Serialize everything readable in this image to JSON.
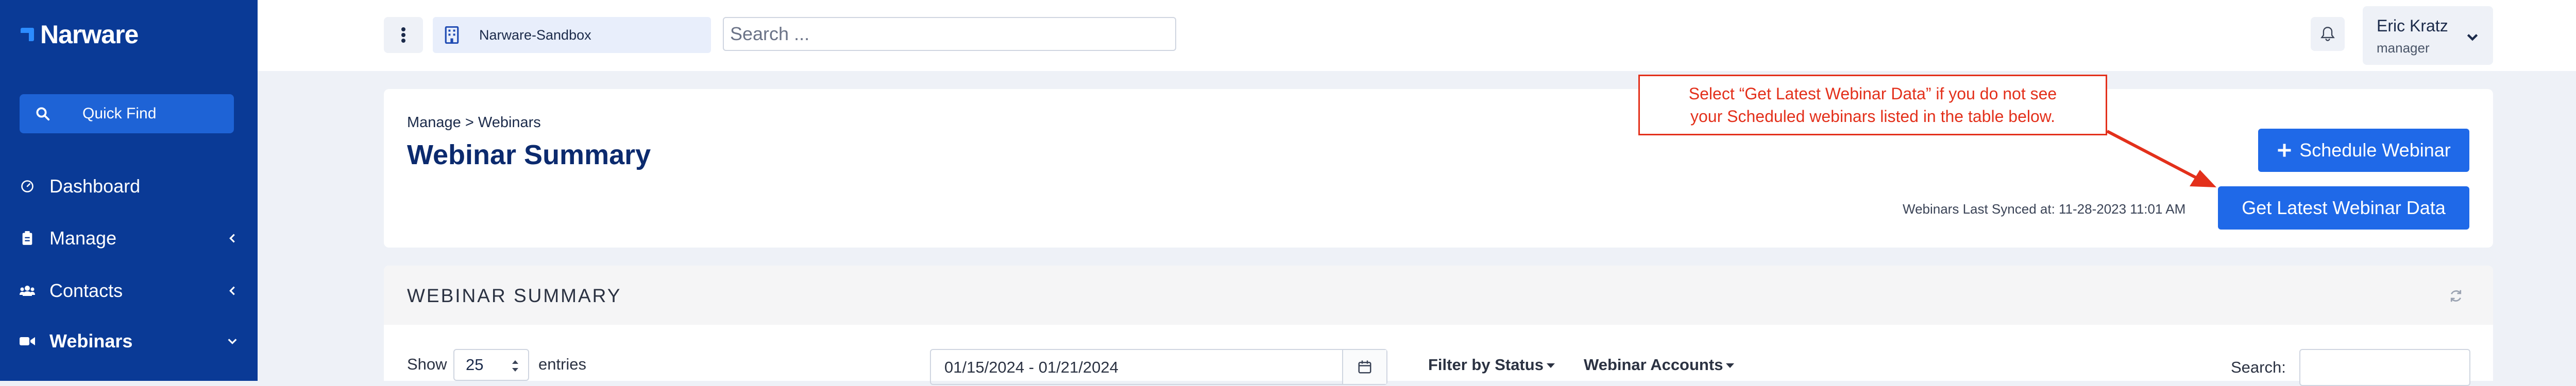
{
  "app": {
    "name": "Narware"
  },
  "sidebar": {
    "quick_find_label": "Quick Find",
    "items": [
      {
        "label": "Dashboard",
        "icon": "gauge-icon"
      },
      {
        "label": "Manage",
        "icon": "clipboard-icon",
        "expandable": true
      },
      {
        "label": "Contacts",
        "icon": "users-icon",
        "expandable": true
      },
      {
        "label": "Webinars",
        "icon": "video-camera-icon",
        "expandable": true,
        "expanded": true
      }
    ]
  },
  "header": {
    "org_name": "Narware-Sandbox",
    "search_placeholder": "Search ...",
    "user_name": "Eric Kratz",
    "user_role": "manager"
  },
  "page": {
    "breadcrumb": "Manage > Webinars",
    "title": "Webinar Summary",
    "schedule_button": "Schedule Webinar",
    "latest_button": "Get Latest Webinar Data",
    "last_synced": "Webinars Last Synced at: 11-28-2023 11:01 AM",
    "callout_line1": "Select “Get Latest Webinar Data” if you do not see",
    "callout_line2": "your Scheduled webinars listed in the table below."
  },
  "table": {
    "title": "WEBINAR SUMMARY",
    "show_label": "Show",
    "entries_value": "25",
    "entries_label": "entries",
    "date_range": "01/15/2024 - 01/21/2024",
    "filter_status": "Filter by Status",
    "webinar_accounts": "Webinar Accounts",
    "search_label": "Search:"
  },
  "colors": {
    "sidebar_bg": "#0a3a96",
    "accent": "#1f69e8",
    "callout": "#e3301b",
    "title": "#0b2a6e"
  }
}
